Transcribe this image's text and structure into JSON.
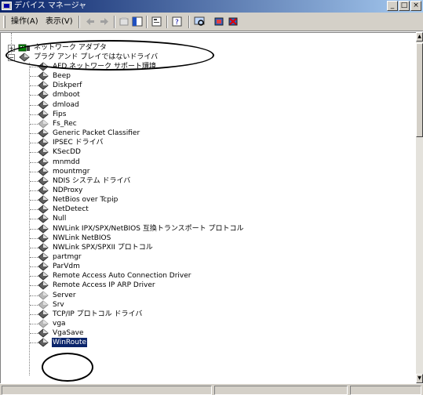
{
  "window": {
    "title": "デバイス マネージャ",
    "minimize": "_",
    "maximize": "□",
    "close": "×"
  },
  "toolbar": {
    "menus": [
      {
        "label": "操作(A)"
      },
      {
        "label": "表示(V)"
      }
    ],
    "icons": [
      "back-icon",
      "forward-icon",
      "up-level-icon",
      "show-hide-tree-icon",
      "properties-icon",
      "help-icon",
      "scan-hardware-icon",
      "update-driver-icon",
      "uninstall-icon"
    ]
  },
  "tree": {
    "category_network": "ネットワーク アダプタ",
    "category_nonpnp": "プラグ アンド プレイではないドライバ",
    "drivers": [
      {
        "label": "AFD ネットワーク サポート環境",
        "disabled": false
      },
      {
        "label": "Beep",
        "disabled": false
      },
      {
        "label": "Diskperf",
        "disabled": false
      },
      {
        "label": "dmboot",
        "disabled": false
      },
      {
        "label": "dmload",
        "disabled": false
      },
      {
        "label": "Fips",
        "disabled": false
      },
      {
        "label": "Fs_Rec",
        "disabled": true
      },
      {
        "label": "Generic Packet Classifier",
        "disabled": false
      },
      {
        "label": "IPSEC ドライバ",
        "disabled": false
      },
      {
        "label": "KSecDD",
        "disabled": false
      },
      {
        "label": "mnmdd",
        "disabled": false
      },
      {
        "label": "mountmgr",
        "disabled": false
      },
      {
        "label": "NDIS システム ドライバ",
        "disabled": false
      },
      {
        "label": "NDProxy",
        "disabled": false
      },
      {
        "label": "NetBios over Tcpip",
        "disabled": false
      },
      {
        "label": "NetDetect",
        "disabled": false
      },
      {
        "label": "Null",
        "disabled": false
      },
      {
        "label": "NWLink IPX/SPX/NetBIOS 互換トランスポート プロトコル",
        "disabled": false
      },
      {
        "label": "NWLink NetBIOS",
        "disabled": false
      },
      {
        "label": "NWLink SPX/SPXII プロトコル",
        "disabled": false
      },
      {
        "label": "partmgr",
        "disabled": false
      },
      {
        "label": "ParVdm",
        "disabled": false
      },
      {
        "label": "Remote Access Auto Connection Driver",
        "disabled": false
      },
      {
        "label": "Remote Access IP ARP Driver",
        "disabled": false
      },
      {
        "label": "Server",
        "disabled": true
      },
      {
        "label": "Srv",
        "disabled": true
      },
      {
        "label": "TCP/IP プロトコル ドライバ",
        "disabled": false
      },
      {
        "label": "vga",
        "disabled": true
      },
      {
        "label": "VgaSave",
        "disabled": false
      },
      {
        "label": "WinRoute",
        "disabled": false,
        "selected": true
      }
    ]
  },
  "colors": {
    "title_gradient_start": "#0a246a",
    "title_gradient_end": "#a6caf0",
    "chrome": "#d4d0c8",
    "selection": "#0a246a",
    "driver_icon": "#606060",
    "driver_icon_disabled": "#b8b8b8",
    "network_icon": "#008000"
  },
  "annotations": [
    "circle-network-category",
    "circle-winroute"
  ]
}
